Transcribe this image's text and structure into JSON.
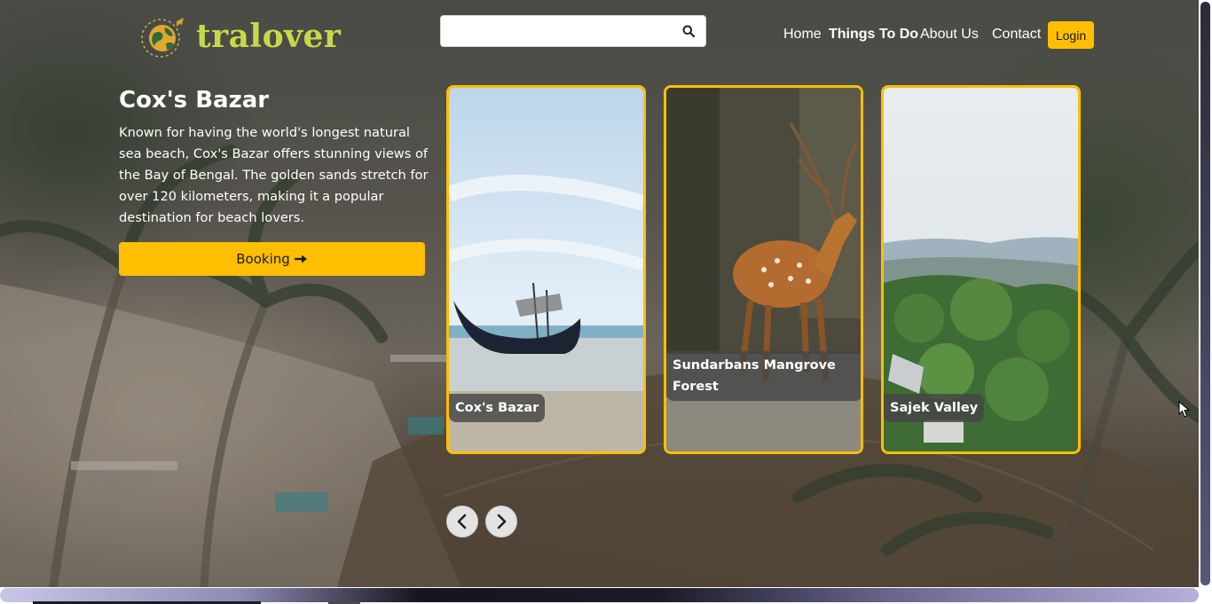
{
  "brand": {
    "name": "tralover",
    "logo_icon": "globe-plane-icon",
    "color": "#c9d84a"
  },
  "search": {
    "value": "",
    "placeholder": "",
    "icon": "search-icon"
  },
  "nav": {
    "items": [
      {
        "label": "Home"
      },
      {
        "label": "Things To Do"
      },
      {
        "label": "About Us"
      },
      {
        "label": "Contact"
      }
    ],
    "login_label": "Login"
  },
  "hero": {
    "title": "Cox's Bazar",
    "description": "Known for having the world's longest natural sea beach, Cox's Bazar offers stunning views of the Bay of Bengal. The golden sands stretch for over 120 kilometers, making it a popular destination for beach lovers.",
    "booking_label": "Booking",
    "booking_icon": "arrow-right-icon"
  },
  "cards": [
    {
      "label": "Cox's Bazar"
    },
    {
      "label": "Sundarbans Mangrove Forest"
    },
    {
      "label": "Sajek Valley"
    }
  ],
  "slider": {
    "prev_icon": "chevron-left-icon",
    "next_icon": "chevron-right-icon"
  },
  "colors": {
    "accent": "#ffbf00",
    "text": "#ffffff"
  }
}
